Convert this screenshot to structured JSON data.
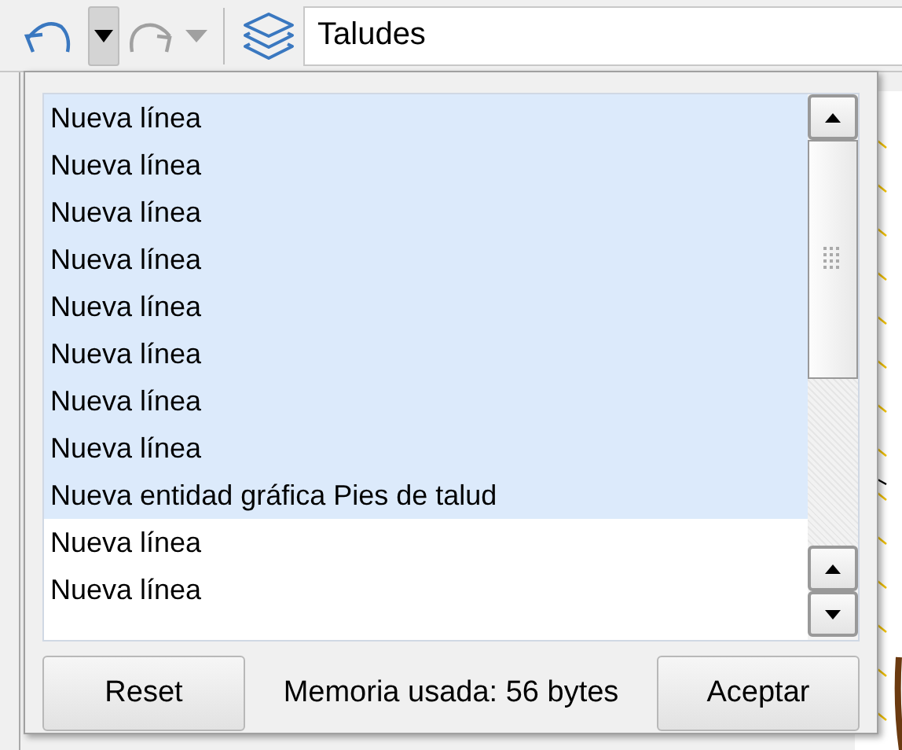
{
  "toolbar": {
    "undo": {
      "disabled": false
    },
    "undo_menu": {
      "expanded": true
    },
    "redo": {
      "disabled": true
    },
    "layer_field": {
      "value": "Taludes"
    }
  },
  "history": {
    "items": [
      {
        "label": "Nueva línea",
        "selected": true
      },
      {
        "label": "Nueva línea",
        "selected": true
      },
      {
        "label": "Nueva línea",
        "selected": true
      },
      {
        "label": "Nueva línea",
        "selected": true
      },
      {
        "label": "Nueva línea",
        "selected": true
      },
      {
        "label": "Nueva línea",
        "selected": true
      },
      {
        "label": "Nueva línea",
        "selected": true
      },
      {
        "label": "Nueva línea",
        "selected": true
      },
      {
        "label": "Nueva entidad gráfica Pies de talud",
        "selected": true
      },
      {
        "label": "Nueva línea",
        "selected": false
      },
      {
        "label": "Nueva línea",
        "selected": false
      }
    ]
  },
  "footer": {
    "reset_button": "Reset",
    "memory": "Memoria usada: 56 bytes",
    "accept_button": "Aceptar"
  }
}
